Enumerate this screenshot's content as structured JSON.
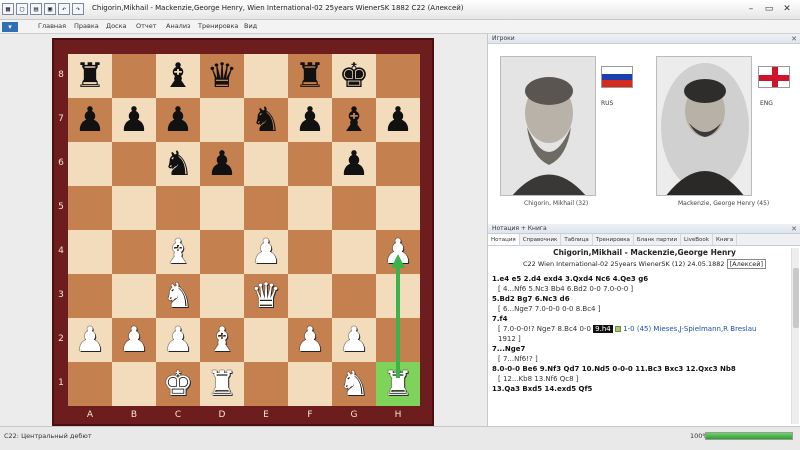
{
  "window": {
    "title": "Chigorin,Mikhail - Mackenzie,George Henry, Wien International-02 25years WienerSK 1882  C22  (Алексей)"
  },
  "ribbon": {
    "tabs": [
      "Главная",
      "Правка",
      "Доска",
      "Отчет",
      "Анализ",
      "Тренировка",
      "Вид"
    ]
  },
  "board": {
    "ranks": [
      "8",
      "7",
      "6",
      "5",
      "4",
      "3",
      "2",
      "1"
    ],
    "files": [
      "A",
      "B",
      "C",
      "D",
      "E",
      "F",
      "G",
      "H"
    ],
    "position": [
      [
        "r",
        "",
        "b",
        "q",
        "",
        "r",
        "k",
        ""
      ],
      [
        "p",
        "p",
        "p",
        "",
        "n",
        "p",
        "b",
        "p"
      ],
      [
        "",
        "",
        "n",
        "p",
        "",
        "",
        "p",
        ""
      ],
      [
        "",
        "",
        "",
        "",
        "",
        "",
        "",
        ""
      ],
      [
        "",
        "",
        "B",
        "",
        "P",
        "",
        "",
        "P"
      ],
      [
        "",
        "",
        "N",
        "",
        "Q",
        "",
        "",
        ""
      ],
      [
        "P",
        "P",
        "P",
        "B",
        "",
        "P",
        "P",
        ""
      ],
      [
        "",
        "",
        "K",
        "R",
        "",
        "",
        "N",
        "R"
      ]
    ],
    "highlight_square": "h1",
    "arrow": {
      "from": "h1",
      "to": "h4",
      "color": "#3cb34a"
    },
    "colors": {
      "light": "#f3dcbc",
      "dark": "#c4804f",
      "frame": "#6d1d1d",
      "highlight": "#7fd25a"
    }
  },
  "players_panel": {
    "header": "Игроки",
    "white": {
      "name": "Chigorin, Mikhail  (32)",
      "flag_code": "RUS"
    },
    "black": {
      "name": "Mackenzie, George Henry  (45)",
      "flag_code": "ENG"
    }
  },
  "notation_panel": {
    "header": "Нотация + Книга",
    "tabs": [
      "Нотация",
      "Справочник",
      "Таблица",
      "Тренировка",
      "Бланк партии",
      "LiveBook",
      "Книга"
    ],
    "game_title": "Chigorin,Mikhail - Mackenzie,George Henry",
    "eco": "C22",
    "event": "Wien International-02 25years WienerSK (12) 24.05.1882",
    "annotator": "[Алексей]",
    "lines": [
      {
        "type": "main",
        "text": "1.e4  e5  2.d4  exd4  3.Qxd4  Nc6  4.Qe3  g6"
      },
      {
        "type": "var",
        "text": "[ 4...Nf6  5.Nc3  Bb4  6.Bd2  0-0  7.0-0-0 ]"
      },
      {
        "type": "main",
        "text": "5.Bd2  Bg7  6.Nc3  d6"
      },
      {
        "type": "var",
        "text": "[ 6...Nge7  7.0-0-0  0-0  8.Bc4 ]"
      },
      {
        "type": "main",
        "text": "7.f4"
      },
      {
        "type": "var-cur",
        "pre": "[ 7.0-0-0!?  Nge7  8.Bc4  0-0 ",
        "cur": "9.h4",
        "post": "1-0 (45) Mieses,J-Spielmann,R Breslau"
      },
      {
        "type": "var",
        "text": "1912 ]"
      },
      {
        "type": "main",
        "text": "7...Nge7"
      },
      {
        "type": "var",
        "text": "[ 7...Nf6!? ]"
      },
      {
        "type": "main",
        "text": "8.0-0-0  Be6  9.Nf3  Qd7  10.Nd5  0-0-0  11.Bc3  Bxc3  12.Qxc3  Nb8"
      },
      {
        "type": "var",
        "text": "[ 12...Kb8  13.Nf6  Qc8 ]"
      },
      {
        "type": "main",
        "text": "13.Qa3  Bxd5  14.exd5  Qf5"
      }
    ]
  },
  "statusbar": {
    "text": "C22: Центральный дебют",
    "zoom": "100%",
    "progress": 1.0
  }
}
